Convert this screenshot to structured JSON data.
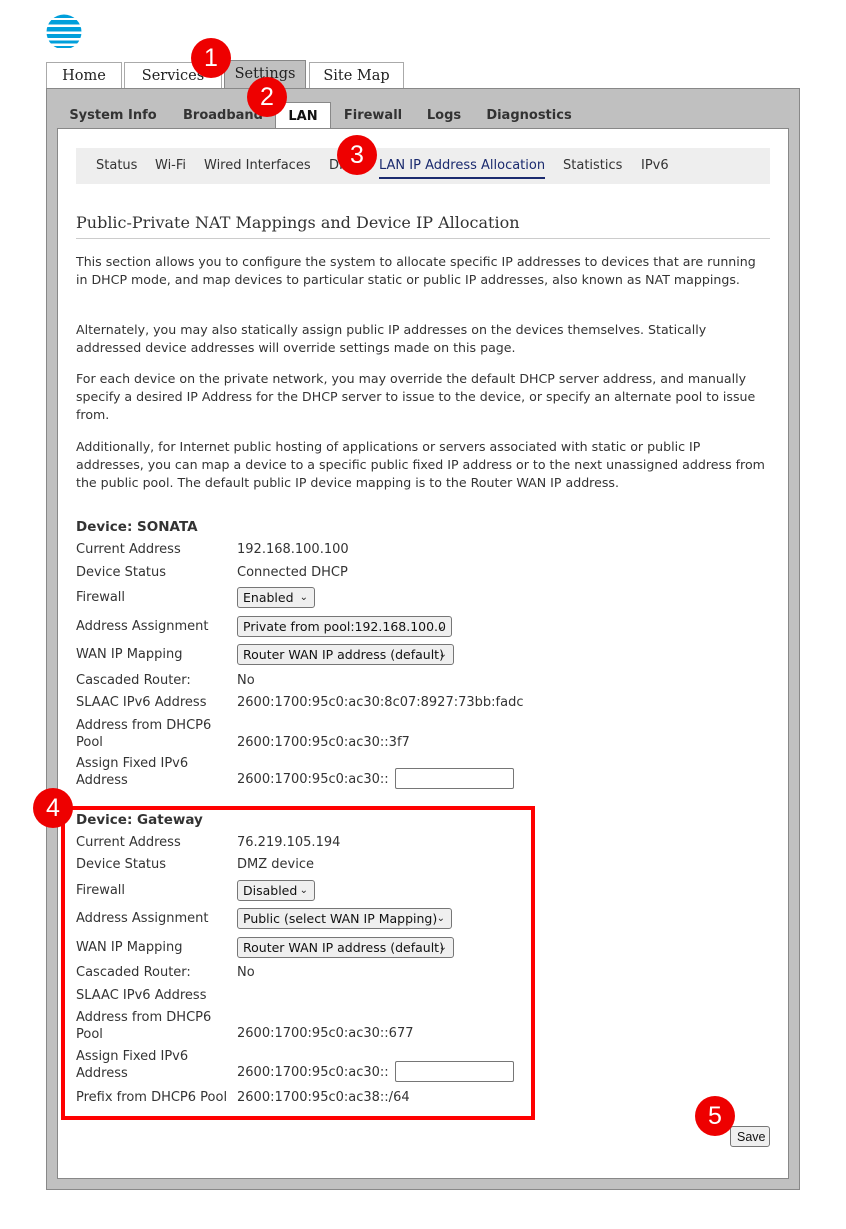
{
  "brand": {
    "logo_icon": "att-globe-icon",
    "color": "#009fdb"
  },
  "top_tabs": [
    {
      "label": "Home",
      "active": false
    },
    {
      "label": "Services",
      "active": false
    },
    {
      "label": "Settings",
      "active": true
    },
    {
      "label": "Site Map",
      "active": false
    }
  ],
  "sub_tabs": [
    {
      "label": "System Info",
      "active": false
    },
    {
      "label": "Broadband",
      "active": false
    },
    {
      "label": "LAN",
      "active": true
    },
    {
      "label": "Firewall",
      "active": false
    },
    {
      "label": "Logs",
      "active": false
    },
    {
      "label": "Diagnostics",
      "active": false
    }
  ],
  "lan_nav": [
    {
      "label": "Status",
      "active": false
    },
    {
      "label": "Wi-Fi",
      "active": false
    },
    {
      "label": "Wired Interfaces",
      "active": false
    },
    {
      "label": "DHCP",
      "active": false
    },
    {
      "label": "LAN IP Address Allocation",
      "active": true
    },
    {
      "label": "Statistics",
      "active": false
    },
    {
      "label": "IPv6",
      "active": false
    }
  ],
  "page": {
    "title": "Public-Private NAT Mappings and Device IP Allocation",
    "paragraphs": [
      "This section allows you to configure the system to allocate specific IP addresses to devices that are running in DHCP mode, and map devices to particular static or public IP addresses, also known as NAT mappings.",
      "Alternately, you may also statically assign public IP addresses on the devices themselves. Statically addressed device addresses will override settings made on this page.",
      "For each device on the private network, you may override the default DHCP server address, and manually specify a desired IP Address for the DHCP server to issue to the device, or specify an alternate pool to issue from.",
      "Additionally, for Internet public hosting of applications or servers associated with static or public IP addresses, you can map a device to a specific public fixed IP address or to the next unassigned address from the public pool. The default public IP device mapping is to the Router WAN IP address."
    ]
  },
  "labels": {
    "current_address": "Current Address",
    "device_status": "Device Status",
    "firewall": "Firewall",
    "address_assignment": "Address Assignment",
    "wan_ip_mapping": "WAN IP Mapping",
    "cascaded_router": "Cascaded Router:",
    "slaac": "SLAAC IPv6 Address",
    "dhcp6_pool_1": "Address from DHCP6",
    "dhcp6_pool_2": "Pool",
    "assign_fixed_1": "Assign Fixed IPv6",
    "assign_fixed_2": "Address",
    "prefix": "Prefix from DHCP6 Pool"
  },
  "devices": [
    {
      "heading": "Device: SONATA",
      "current_address": "192.168.100.100",
      "device_status": "Connected DHCP",
      "firewall": "Enabled",
      "address_assignment": "Private from pool:192.168.100.0",
      "wan_ip_mapping": "Router WAN IP address (default)",
      "cascaded_router": "No",
      "slaac": "2600:1700:95c0:ac30:8c07:8927:73bb:fadc",
      "dhcp6_pool": "2600:1700:95c0:ac30::3f7",
      "assign_fixed_prefix": "2600:1700:95c0:ac30::",
      "assign_fixed_value": ""
    },
    {
      "heading": "Device: Gateway",
      "current_address": "76.219.105.194",
      "device_status": "DMZ device",
      "firewall": "Disabled",
      "address_assignment": "Public (select WAN IP Mapping)",
      "wan_ip_mapping": "Router WAN IP address (default)",
      "cascaded_router": "No",
      "slaac": "",
      "dhcp6_pool": "2600:1700:95c0:ac30::677",
      "assign_fixed_prefix": "2600:1700:95c0:ac30::",
      "assign_fixed_value": "",
      "prefix_dhcp6": "2600:1700:95c0:ac38::/64"
    }
  ],
  "save_label": "Save",
  "annotations": [
    "1",
    "2",
    "3",
    "4",
    "5"
  ],
  "annotation_color": "#ee0000",
  "chevron": "⌄"
}
